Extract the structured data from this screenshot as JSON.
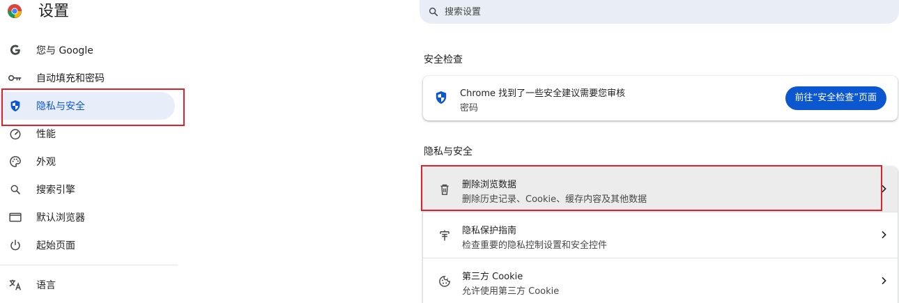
{
  "header": {
    "title": "设置",
    "logo_icon": "chrome-logo-icon"
  },
  "search": {
    "placeholder": "搜索设置",
    "icon": "search-icon"
  },
  "sidebar": {
    "items": [
      {
        "label": "您与 Google",
        "icon": "google-g-icon"
      },
      {
        "label": "自动填充和密码",
        "icon": "key-icon"
      },
      {
        "label": "隐私与安全",
        "icon": "shield-icon",
        "active": true
      },
      {
        "label": "性能",
        "icon": "speedometer-icon"
      },
      {
        "label": "外观",
        "icon": "palette-icon"
      },
      {
        "label": "搜索引擎",
        "icon": "search-icon"
      },
      {
        "label": "默认浏览器",
        "icon": "browser-window-icon"
      },
      {
        "label": "起始页面",
        "icon": "power-icon"
      },
      {
        "label": "语言",
        "icon": "translate-icon"
      }
    ]
  },
  "safety_check": {
    "section_title": "安全检查",
    "title": "Chrome 找到了一些安全建议需要您审核",
    "subtitle": "密码",
    "button_label": "前往“安全检查”页面"
  },
  "privacy": {
    "section_title": "隐私与安全",
    "rows": [
      {
        "title": "删除浏览数据",
        "subtitle": "删除历史记录、Cookie、缓存内容及其他数据",
        "icon": "trash-icon"
      },
      {
        "title": "隐私保护指南",
        "subtitle": "检查重要的隐私控制设置和安全控件",
        "icon": "privacy-guide-icon"
      },
      {
        "title": "第三方 Cookie",
        "subtitle": "允许使用第三方 Cookie",
        "icon": "cookie-icon"
      }
    ]
  },
  "colors": {
    "accent": "#0b57d0",
    "active_bg": "#e8eef9",
    "highlight": "#e0202a"
  }
}
